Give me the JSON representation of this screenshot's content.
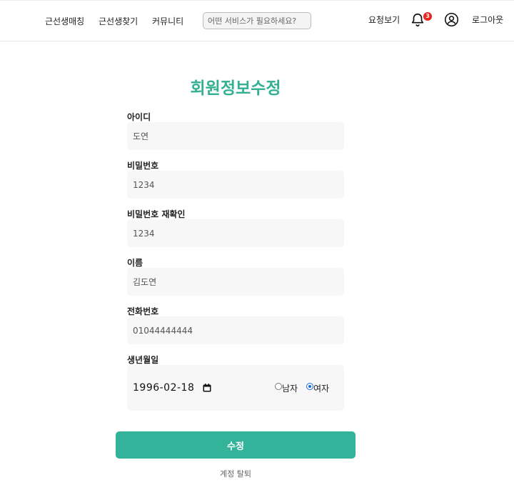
{
  "header": {
    "nav": [
      "근선생매칭",
      "근선생찾기",
      "커뮤니티"
    ],
    "search_placeholder": "어떤 서비스가 필요하세요?",
    "request_view": "요청보기",
    "notification_count": "3",
    "logout": "로그아웃",
    "icons": {
      "bell": "bell-icon",
      "user": "user-circle-icon"
    }
  },
  "form": {
    "title": "회원정보수정",
    "fields": [
      {
        "label": "아이디",
        "value": "도연"
      },
      {
        "label": "비밀번호",
        "value": "1234"
      },
      {
        "label": "비밀번호 재확인",
        "value": "1234"
      },
      {
        "label": "이름",
        "value": "김도연"
      },
      {
        "label": "전화번호",
        "value": "01044444444"
      }
    ],
    "birth": {
      "label": "생년월일",
      "value": "1996-02-18",
      "gender_options": [
        "남자",
        "여자"
      ],
      "gender_selected": "여자"
    },
    "submit_label": "수정",
    "withdraw_label": "계정 탈퇴"
  },
  "colors": {
    "accent": "#33b094",
    "button": "#33b39a",
    "badge": "#e8251f"
  }
}
